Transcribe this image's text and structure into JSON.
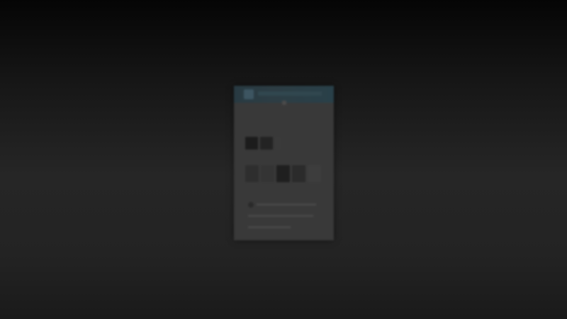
{
  "colors": {
    "background": "#262626",
    "panel": "#393939",
    "header": "#2b3c43"
  },
  "icons": {
    "logo": "app-logo-icon",
    "status": "status-icon"
  },
  "swatches_row_a": [
    {
      "color": "#1c1c1c"
    },
    {
      "color": "#232323"
    },
    {
      "color": "#3a3a3a"
    }
  ],
  "swatches_row_b": [
    {
      "color": "#2e2e2e"
    },
    {
      "color": "#343434"
    },
    {
      "color": "#1f1f1f"
    },
    {
      "color": "#2b2b2b"
    },
    {
      "color": "#3d3d3d"
    }
  ]
}
